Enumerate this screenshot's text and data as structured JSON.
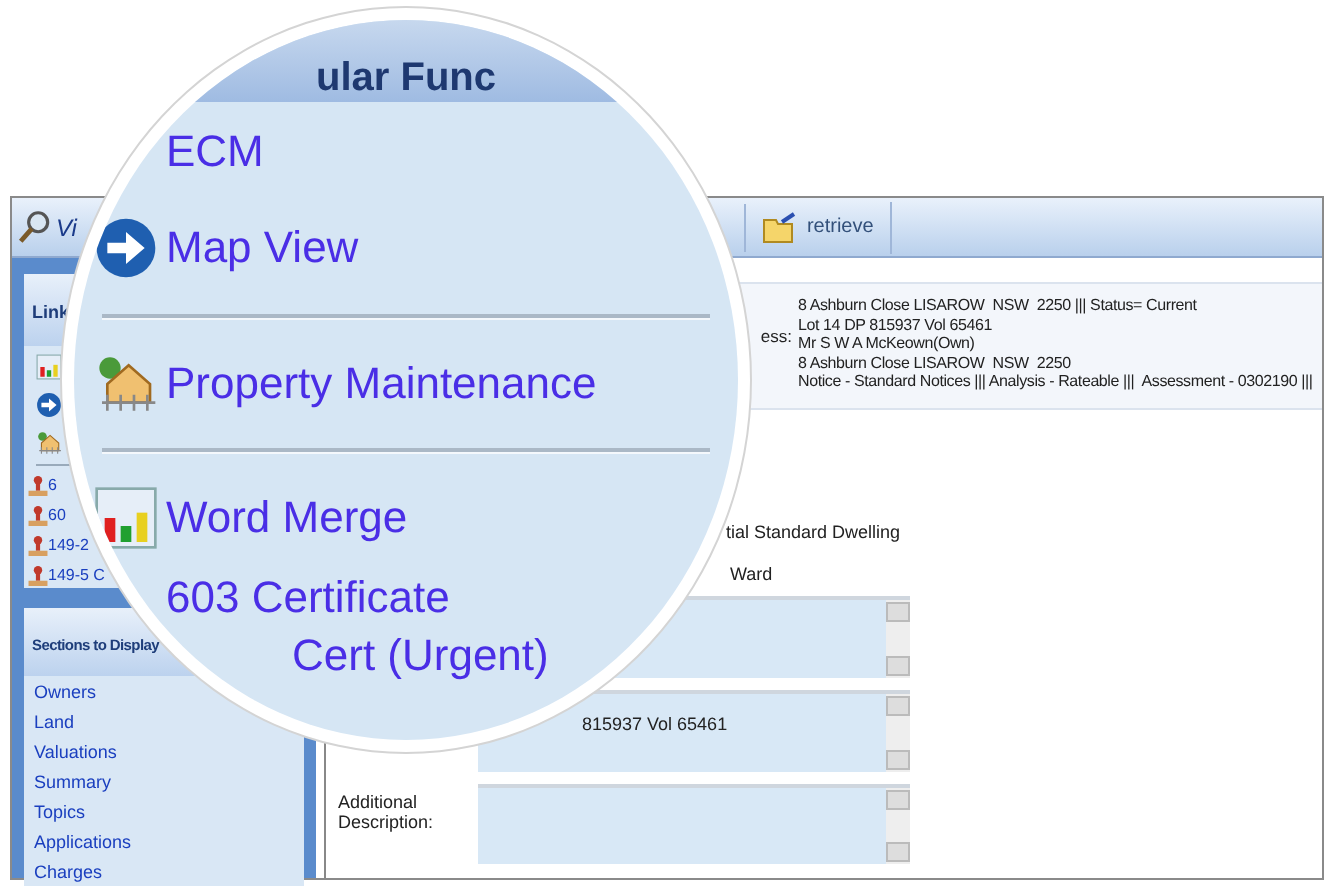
{
  "toolbar": {
    "view_button": "Vi",
    "retrieve_button": "retrieve"
  },
  "links_panel": {
    "title": "Link",
    "icon_rows": [
      {
        "kind": "chart"
      },
      {
        "kind": "arrow"
      },
      {
        "kind": "house"
      }
    ],
    "items": [
      "6",
      "60",
      "149-2",
      "149-5 C"
    ]
  },
  "sections_panel": {
    "title": "Sections to Display",
    "items": [
      "Owners",
      "Land",
      "Valuations",
      "Summary",
      "Topics",
      "Applications",
      "Charges"
    ]
  },
  "property_summary": {
    "label": "ess:",
    "lines": [
      "8 Ashburn Close LISAROW  NSW  2250 ||| Status= Current",
      "Lot 14 DP 815937 Vol 65461",
      "Mr S W A McKeown(Own)",
      "8 Ashburn Close LISAROW  NSW  2250",
      "Notice - Standard Notices ||| Analysis - Rateable |||  Assessment - 0302190 |||"
    ]
  },
  "form": {
    "texts": [
      "tial Standard Dwelling",
      "Ward"
    ],
    "title_value": "815937 Vol 65461",
    "additional_description_label": "Additional Description:"
  },
  "magnifier": {
    "title": "ular Func",
    "items": [
      {
        "label": "ECM",
        "kind": "plain",
        "divider_after": false
      },
      {
        "label": "Map View",
        "kind": "arrow",
        "divider_after": true
      },
      {
        "label": "Property Maintenance",
        "kind": "house",
        "divider_after": true
      },
      {
        "label": "Word Merge",
        "kind": "chart",
        "divider_after": false
      },
      {
        "label": "603 Certificate",
        "kind": "plain",
        "divider_after": false
      },
      {
        "label": "Cert (Urgent)",
        "kind": "partial",
        "divider_after": false
      }
    ]
  }
}
